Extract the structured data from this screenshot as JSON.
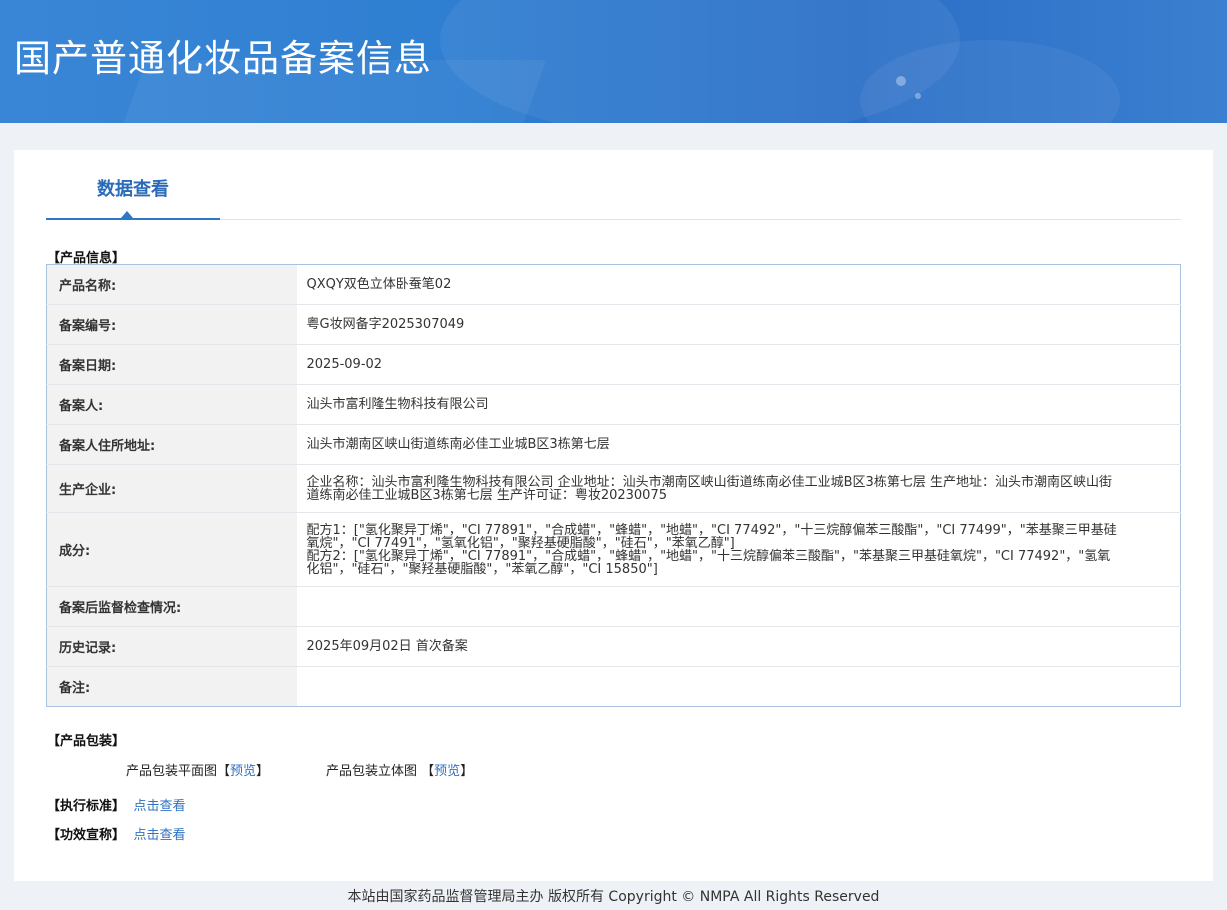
{
  "header": {
    "title": "国产普通化妆品备案信息"
  },
  "tab": {
    "label": "数据查看"
  },
  "sections": {
    "product_info": "【产品信息】",
    "packaging": "【产品包装】",
    "standard": "【执行标准】",
    "efficacy": "【功效宣称】"
  },
  "product": {
    "rows": [
      {
        "label": "产品名称:",
        "value": "QXQY双色立体卧蚕笔02"
      },
      {
        "label": "备案编号:",
        "value": "粤G妆网备字2025307049"
      },
      {
        "label": "备案日期:",
        "value": "2025-09-02"
      },
      {
        "label": "备案人:",
        "value": "汕头市富利隆生物科技有限公司"
      },
      {
        "label": "备案人住所地址:",
        "value": "汕头市潮南区峡山街道练南必佳工业城B区3栋第七层"
      },
      {
        "label": "生产企业:",
        "value": "企业名称：汕头市富利隆生物科技有限公司 企业地址：汕头市潮南区峡山街道练南必佳工业城B区3栋第七层 生产地址：汕头市潮南区峡山街道练南必佳工业城B区3栋第七层 生产许可证：粤妆20230075"
      },
      {
        "label": "成分:",
        "value_lines": [
          "配方1：[\"氢化聚异丁烯\"，\"CI 77891\"，\"合成蜡\"，\"蜂蜡\"，\"地蜡\"，\"CI 77492\"，\"十三烷醇偏苯三酸酯\"，\"CI 77499\"，\"苯基聚三甲基硅氧烷\"，\"CI 77491\"，\"氢氧化铝\"，\"聚羟基硬脂酸\"，\"硅石\"，\"苯氧乙醇\"]",
          "配方2：[\"氢化聚异丁烯\"，\"CI 77891\"，\"合成蜡\"，\"蜂蜡\"，\"地蜡\"，\"十三烷醇偏苯三酸酯\"，\"苯基聚三甲基硅氧烷\"，\"CI 77492\"，\"氢氧化铝\"，\"硅石\"，\"聚羟基硬脂酸\"，\"苯氧乙醇\"，\"CI 15850\"]"
        ]
      },
      {
        "label": "备案后监督检查情况:",
        "value": ""
      },
      {
        "label": "历史记录:",
        "value": "2025年09月02日 首次备案"
      },
      {
        "label": "备注:",
        "value": ""
      }
    ]
  },
  "packaging": {
    "flat_label": "产品包装平面图",
    "solid_label": "产品包装立体图",
    "bracket_open": "【",
    "bracket_close": "】",
    "preview": "预览"
  },
  "links": {
    "view": "点击查看"
  },
  "footer": {
    "text": "本站由国家药品监督管理局主办 版权所有 Copyright © NMPA All Rights Reserved"
  },
  "colors": {
    "banner": "#2f7fd2",
    "accent": "#2f77c8",
    "link": "#2f72c0"
  }
}
